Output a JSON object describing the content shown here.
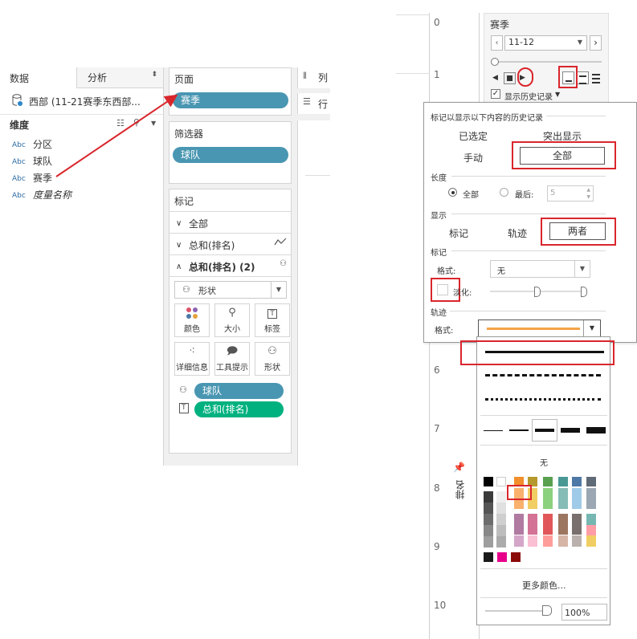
{
  "left_panel": {
    "tabs": [
      {
        "label": "数据"
      },
      {
        "label": "分析"
      }
    ],
    "datasource": "西部 (11-21赛季东西部...",
    "dimensions_header": "维度",
    "fields": [
      {
        "type": "Abc",
        "name": "分区"
      },
      {
        "type": "Abc",
        "name": "球队"
      },
      {
        "type": "Abc",
        "name": "赛季"
      },
      {
        "type": "Abc",
        "name": "度量名称"
      }
    ]
  },
  "cards": {
    "pages": {
      "title": "页面",
      "pill": "赛季"
    },
    "filters": {
      "title": "筛选器",
      "pill": "球队"
    },
    "marks": {
      "title": "标记",
      "rows": [
        {
          "label": "全部"
        },
        {
          "label": "总和(排名)"
        },
        {
          "label": "总和(排名) (2)"
        }
      ],
      "type_select": "形状",
      "buttons": [
        {
          "label": "颜色",
          "icon": "color-icon"
        },
        {
          "label": "大小",
          "icon": "size-icon"
        },
        {
          "label": "标签",
          "icon": "label-icon"
        },
        {
          "label": "详细信息",
          "icon": "detail-icon"
        },
        {
          "label": "工具提示",
          "icon": "tooltip-icon"
        },
        {
          "label": "形状",
          "icon": "shape-icon"
        }
      ],
      "shelf_pills": [
        {
          "label": "球队",
          "color": "#4996b2"
        },
        {
          "label": "总和(排名)",
          "color": "#00b180"
        }
      ]
    }
  },
  "shelves": {
    "columns": "列",
    "rows": "行"
  },
  "axis": {
    "ticks": [
      "0",
      "1",
      "6",
      "7",
      "8",
      "9",
      "10"
    ],
    "title": "排名"
  },
  "season_card": {
    "title": "赛季",
    "value": "11-12",
    "show_history": "显示历史记录"
  },
  "history_popup": {
    "heading": "标记以显示以下内容的历史记录",
    "options_row1": [
      "已选定",
      "突出显示"
    ],
    "options_row2": [
      "手动",
      "全部"
    ],
    "length_label": "长度",
    "length_options": [
      "全部",
      "最后:"
    ],
    "length_value": "5",
    "display_label": "显示",
    "display_options": [
      "标记",
      "轨迹",
      "两者"
    ],
    "marks_label": "标记",
    "format_label": "格式:",
    "format_value": "无",
    "fade_label": "淡化:",
    "trail_label": "轨迹",
    "trail_format_label": "格式:",
    "trail_color": "#f4a347"
  },
  "format_popup": {
    "none_label": "无",
    "more_colors": "更多颜色...",
    "opacity": "100%",
    "palette_top": [
      "#000000",
      "#ffffff",
      "#f28e2b",
      "#b6992d",
      "#59a14f",
      "#499894",
      "#4e79a7",
      "#5f6b76"
    ],
    "palette_mid": [
      "#f9b16d",
      "#f1ce63",
      "#8cd17d",
      "#86bcb6",
      "#a0cbe8",
      "#9ba7b2"
    ],
    "palette_row3": [
      "#b07aa1",
      "#d37295",
      "#e15759",
      "#9d7660",
      "#79706e",
      "#76b7b2"
    ],
    "palette_row4": [
      "#d4a6c8",
      "#fabfd2",
      "#ff9d9a",
      "#d7b5a6",
      "#bab0ac",
      "#ff9da7",
      "#f1ce63"
    ],
    "extras": [
      "#1a1a1a",
      "#e8008b",
      "#8a0a0a"
    ]
  }
}
